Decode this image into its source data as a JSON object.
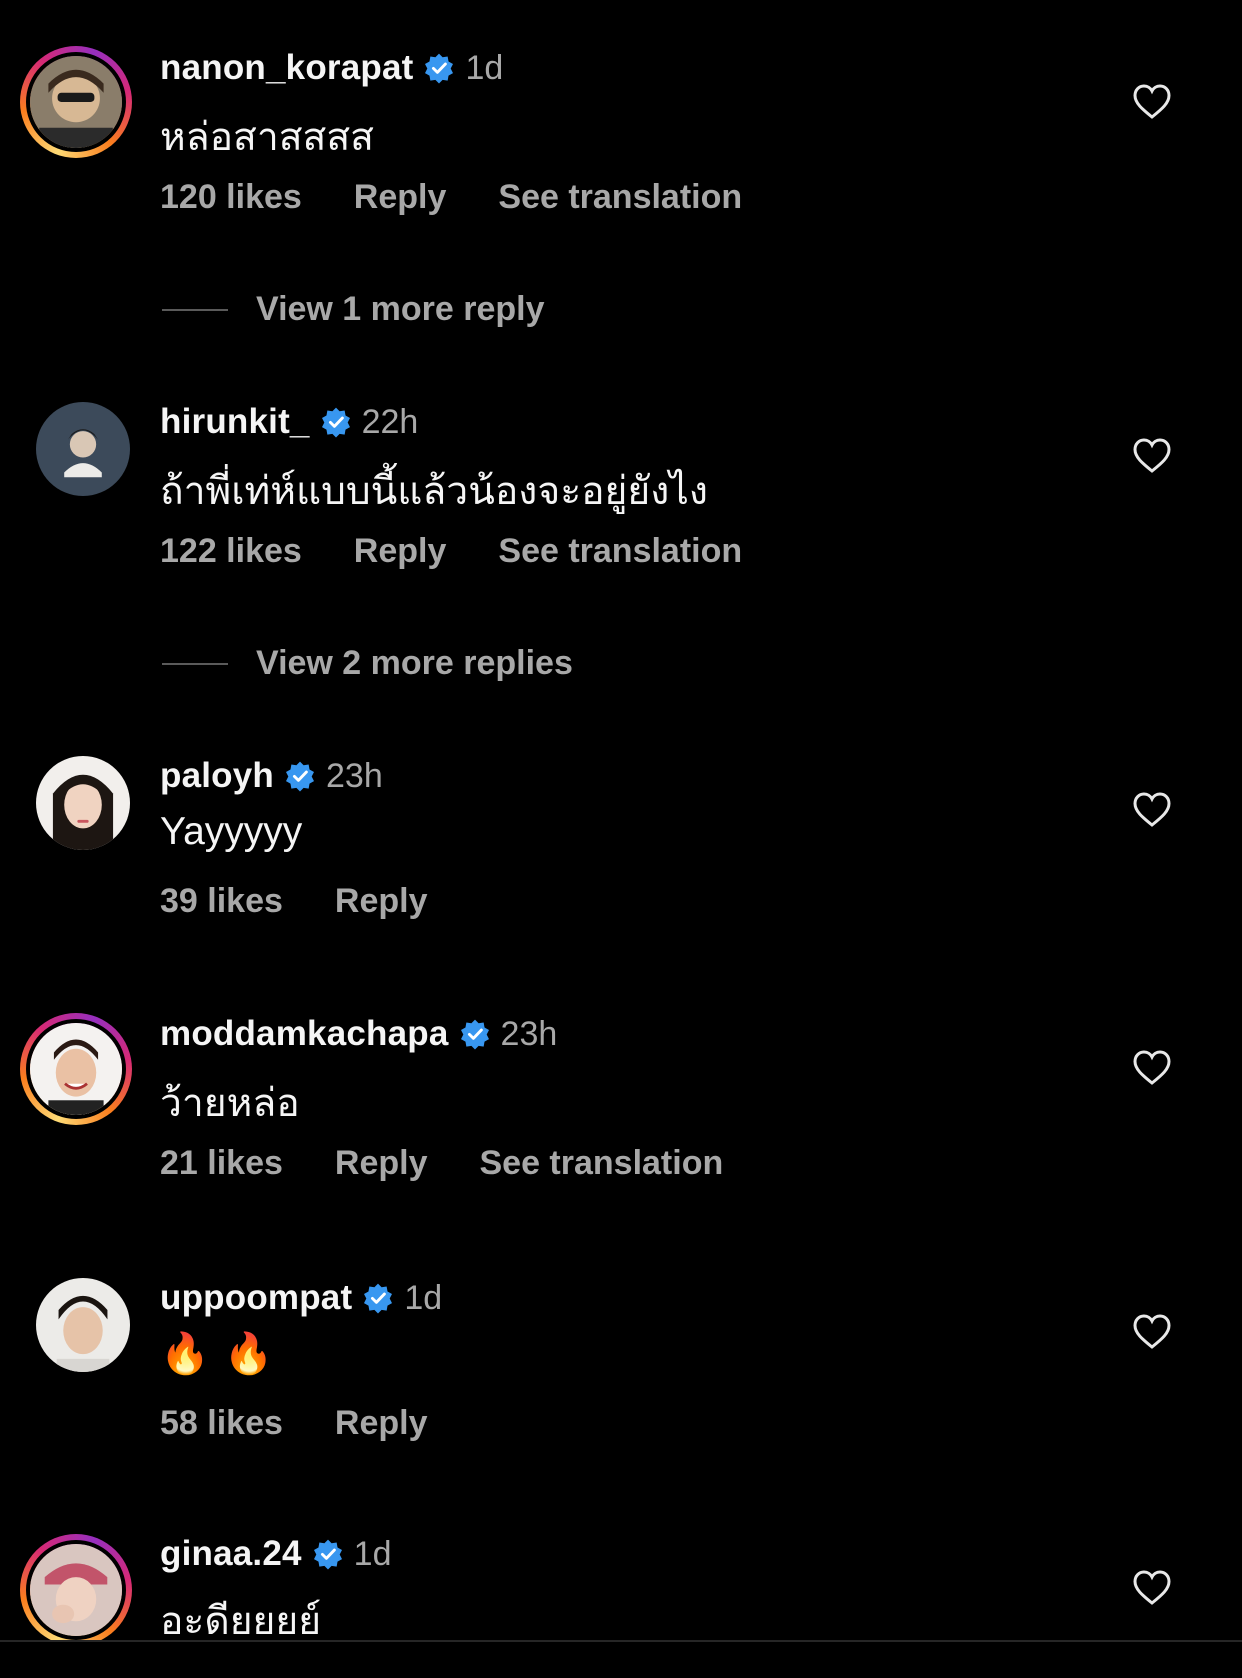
{
  "ui": {
    "verified_color": "#3897f0",
    "meta_color": "#a8a8a8",
    "background": "#000000"
  },
  "comments": [
    {
      "username": "nanon_korapat",
      "time": "1d",
      "text": "หล่อสาสสสส",
      "likes": "120 likes",
      "reply": "Reply",
      "translate": "See translation",
      "more_replies": "View 1 more reply"
    },
    {
      "username": "hirunkit_",
      "time": "22h",
      "text": "ถ้าพี่เท่ห์แบบนี้แล้วน้องจะอยู่ยังไง",
      "likes": "122 likes",
      "reply": "Reply",
      "translate": "See translation",
      "more_replies": "View 2 more replies"
    },
    {
      "username": "paloyh",
      "time": "23h",
      "text": "Yayyyyy",
      "likes": "39 likes",
      "reply": "Reply"
    },
    {
      "username": "moddamkachapa",
      "time": "23h",
      "text": "ว้ายหล่อ",
      "likes": "21 likes",
      "reply": "Reply",
      "translate": "See translation"
    },
    {
      "username": "uppoompat",
      "time": "1d",
      "text": "🔥🔥",
      "likes": "58 likes",
      "reply": "Reply"
    },
    {
      "username": "ginaa.24",
      "time": "1d",
      "text": "อะดียยยย์"
    }
  ]
}
